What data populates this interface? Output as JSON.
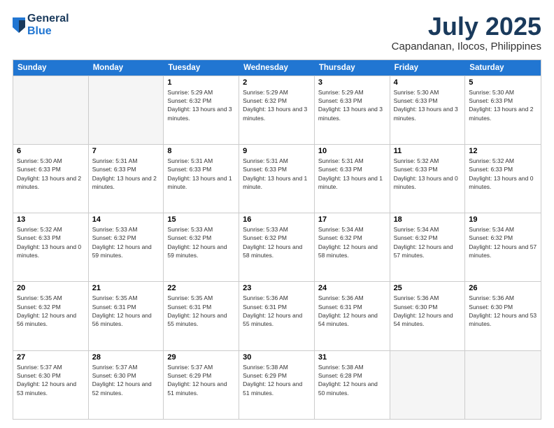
{
  "logo": {
    "general": "General",
    "blue": "Blue"
  },
  "title": "July 2025",
  "subtitle": "Capandanan, Ilocos, Philippines",
  "header_days": [
    "Sunday",
    "Monday",
    "Tuesday",
    "Wednesday",
    "Thursday",
    "Friday",
    "Saturday"
  ],
  "weeks": [
    [
      {
        "date": "",
        "sunrise": "",
        "sunset": "",
        "daylight": "",
        "empty": true
      },
      {
        "date": "",
        "sunrise": "",
        "sunset": "",
        "daylight": "",
        "empty": true
      },
      {
        "date": "1",
        "sunrise": "Sunrise: 5:29 AM",
        "sunset": "Sunset: 6:32 PM",
        "daylight": "Daylight: 13 hours and 3 minutes."
      },
      {
        "date": "2",
        "sunrise": "Sunrise: 5:29 AM",
        "sunset": "Sunset: 6:32 PM",
        "daylight": "Daylight: 13 hours and 3 minutes."
      },
      {
        "date": "3",
        "sunrise": "Sunrise: 5:29 AM",
        "sunset": "Sunset: 6:33 PM",
        "daylight": "Daylight: 13 hours and 3 minutes."
      },
      {
        "date": "4",
        "sunrise": "Sunrise: 5:30 AM",
        "sunset": "Sunset: 6:33 PM",
        "daylight": "Daylight: 13 hours and 3 minutes."
      },
      {
        "date": "5",
        "sunrise": "Sunrise: 5:30 AM",
        "sunset": "Sunset: 6:33 PM",
        "daylight": "Daylight: 13 hours and 2 minutes."
      }
    ],
    [
      {
        "date": "6",
        "sunrise": "Sunrise: 5:30 AM",
        "sunset": "Sunset: 6:33 PM",
        "daylight": "Daylight: 13 hours and 2 minutes."
      },
      {
        "date": "7",
        "sunrise": "Sunrise: 5:31 AM",
        "sunset": "Sunset: 6:33 PM",
        "daylight": "Daylight: 13 hours and 2 minutes."
      },
      {
        "date": "8",
        "sunrise": "Sunrise: 5:31 AM",
        "sunset": "Sunset: 6:33 PM",
        "daylight": "Daylight: 13 hours and 1 minute."
      },
      {
        "date": "9",
        "sunrise": "Sunrise: 5:31 AM",
        "sunset": "Sunset: 6:33 PM",
        "daylight": "Daylight: 13 hours and 1 minute."
      },
      {
        "date": "10",
        "sunrise": "Sunrise: 5:31 AM",
        "sunset": "Sunset: 6:33 PM",
        "daylight": "Daylight: 13 hours and 1 minute."
      },
      {
        "date": "11",
        "sunrise": "Sunrise: 5:32 AM",
        "sunset": "Sunset: 6:33 PM",
        "daylight": "Daylight: 13 hours and 0 minutes."
      },
      {
        "date": "12",
        "sunrise": "Sunrise: 5:32 AM",
        "sunset": "Sunset: 6:33 PM",
        "daylight": "Daylight: 13 hours and 0 minutes."
      }
    ],
    [
      {
        "date": "13",
        "sunrise": "Sunrise: 5:32 AM",
        "sunset": "Sunset: 6:33 PM",
        "daylight": "Daylight: 13 hours and 0 minutes."
      },
      {
        "date": "14",
        "sunrise": "Sunrise: 5:33 AM",
        "sunset": "Sunset: 6:32 PM",
        "daylight": "Daylight: 12 hours and 59 minutes."
      },
      {
        "date": "15",
        "sunrise": "Sunrise: 5:33 AM",
        "sunset": "Sunset: 6:32 PM",
        "daylight": "Daylight: 12 hours and 59 minutes."
      },
      {
        "date": "16",
        "sunrise": "Sunrise: 5:33 AM",
        "sunset": "Sunset: 6:32 PM",
        "daylight": "Daylight: 12 hours and 58 minutes."
      },
      {
        "date": "17",
        "sunrise": "Sunrise: 5:34 AM",
        "sunset": "Sunset: 6:32 PM",
        "daylight": "Daylight: 12 hours and 58 minutes."
      },
      {
        "date": "18",
        "sunrise": "Sunrise: 5:34 AM",
        "sunset": "Sunset: 6:32 PM",
        "daylight": "Daylight: 12 hours and 57 minutes."
      },
      {
        "date": "19",
        "sunrise": "Sunrise: 5:34 AM",
        "sunset": "Sunset: 6:32 PM",
        "daylight": "Daylight: 12 hours and 57 minutes."
      }
    ],
    [
      {
        "date": "20",
        "sunrise": "Sunrise: 5:35 AM",
        "sunset": "Sunset: 6:32 PM",
        "daylight": "Daylight: 12 hours and 56 minutes."
      },
      {
        "date": "21",
        "sunrise": "Sunrise: 5:35 AM",
        "sunset": "Sunset: 6:31 PM",
        "daylight": "Daylight: 12 hours and 56 minutes."
      },
      {
        "date": "22",
        "sunrise": "Sunrise: 5:35 AM",
        "sunset": "Sunset: 6:31 PM",
        "daylight": "Daylight: 12 hours and 55 minutes."
      },
      {
        "date": "23",
        "sunrise": "Sunrise: 5:36 AM",
        "sunset": "Sunset: 6:31 PM",
        "daylight": "Daylight: 12 hours and 55 minutes."
      },
      {
        "date": "24",
        "sunrise": "Sunrise: 5:36 AM",
        "sunset": "Sunset: 6:31 PM",
        "daylight": "Daylight: 12 hours and 54 minutes."
      },
      {
        "date": "25",
        "sunrise": "Sunrise: 5:36 AM",
        "sunset": "Sunset: 6:30 PM",
        "daylight": "Daylight: 12 hours and 54 minutes."
      },
      {
        "date": "26",
        "sunrise": "Sunrise: 5:36 AM",
        "sunset": "Sunset: 6:30 PM",
        "daylight": "Daylight: 12 hours and 53 minutes."
      }
    ],
    [
      {
        "date": "27",
        "sunrise": "Sunrise: 5:37 AM",
        "sunset": "Sunset: 6:30 PM",
        "daylight": "Daylight: 12 hours and 53 minutes."
      },
      {
        "date": "28",
        "sunrise": "Sunrise: 5:37 AM",
        "sunset": "Sunset: 6:30 PM",
        "daylight": "Daylight: 12 hours and 52 minutes."
      },
      {
        "date": "29",
        "sunrise": "Sunrise: 5:37 AM",
        "sunset": "Sunset: 6:29 PM",
        "daylight": "Daylight: 12 hours and 51 minutes."
      },
      {
        "date": "30",
        "sunrise": "Sunrise: 5:38 AM",
        "sunset": "Sunset: 6:29 PM",
        "daylight": "Daylight: 12 hours and 51 minutes."
      },
      {
        "date": "31",
        "sunrise": "Sunrise: 5:38 AM",
        "sunset": "Sunset: 6:28 PM",
        "daylight": "Daylight: 12 hours and 50 minutes."
      },
      {
        "date": "",
        "sunrise": "",
        "sunset": "",
        "daylight": "",
        "empty": true
      },
      {
        "date": "",
        "sunrise": "",
        "sunset": "",
        "daylight": "",
        "empty": true
      }
    ]
  ]
}
